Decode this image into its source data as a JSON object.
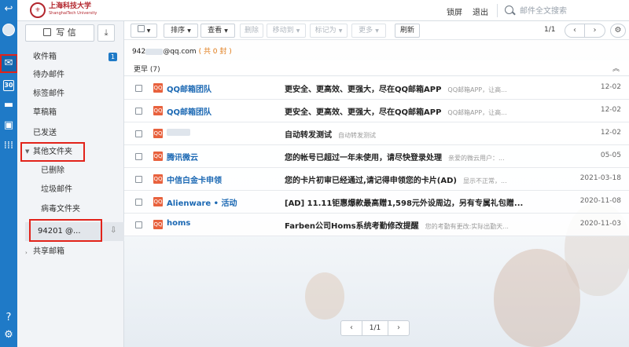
{
  "header": {
    "logo_cn": "上海科技大学",
    "logo_en": "ShanghaiTech University",
    "lock_label": "锁屏",
    "logout_label": "退出",
    "search_placeholder": "邮件全文搜索"
  },
  "sidebar": {
    "compose_label": "写 信",
    "inbox_label": "收件箱",
    "inbox_badge": "1",
    "todo_label": "待办邮件",
    "tagged_label": "标签邮件",
    "drafts_label": "草稿箱",
    "sent_label": "已发送",
    "other_folders_label": "其他文件夹",
    "deleted_label": "已删除",
    "spam_label": "垃圾邮件",
    "virus_label": "病毒文件夹",
    "account_label": "94201 @...",
    "shared_label": "共享邮箱"
  },
  "toolbar": {
    "sort_label": "排序",
    "view_label": "查看",
    "delete_label": "删除",
    "move_label": "移动到",
    "mark_label": "标记为",
    "more_label": "更多",
    "refresh_label": "刷新",
    "page_indicator": "1/1"
  },
  "mail_list": {
    "account_prefix": "942",
    "account_suffix": "@qq.com",
    "count_text": "( 共 0 封 )",
    "group_title": "更早 (7)",
    "qq_icon": "QQ",
    "rows": [
      {
        "sender": "QQ邮箱团队",
        "subject": "更安全、更高效、更强大，尽在QQ邮箱APP",
        "preview": "QQ邮箱APP，让高...",
        "date": "12-02"
      },
      {
        "sender": "QQ邮箱团队",
        "subject": "更安全、更高效、更强大，尽在QQ邮箱APP",
        "preview": "QQ邮箱APP，让高...",
        "date": "12-02"
      },
      {
        "sender": "",
        "subject": "自动转发测试",
        "preview": "自动转发测试",
        "date": "12-02"
      },
      {
        "sender": "腾讯微云",
        "subject": "您的帐号已超过一年未使用，请尽快登录处理",
        "preview": "亲爱的微云用户：...",
        "date": "05-05"
      },
      {
        "sender": "中信白金卡申领",
        "subject": "您的卡片初审已经通过,请记得申领您的卡片(AD)",
        "preview": "显示不正常，...",
        "date": "2021-03-18"
      },
      {
        "sender": "Alienware • 活动",
        "subject": "[AD] 11.11钜惠爆款最高赠1,598元外设周边，另有专属礼包赠...",
        "preview": "",
        "date": "2020-11-08"
      },
      {
        "sender": "homs",
        "subject": "Farben公司Homs系统考勤修改提醒",
        "preview": "您的考勤有更改:实际出勤天...",
        "date": "2020-11-03"
      }
    ]
  },
  "pagination": {
    "label": "1/1"
  },
  "icons": {
    "back": "back-icon",
    "avatar": "avatar-icon",
    "mail": "mail-icon",
    "calendar": "calendar-icon",
    "folder": "folder-icon",
    "contacts": "contacts-icon",
    "apps": "apps-grid-icon",
    "help": "help-icon",
    "settings": "settings-gear-icon",
    "search": "search-icon",
    "compose": "pen-icon",
    "upload": "upload-icon",
    "qq": "qq-mail-icon"
  },
  "colors": {
    "rail": "#1f7ac7",
    "sender_link": "#1b68b3",
    "highlight_box": "#e2231a",
    "qq_badge": "#e8613d"
  },
  "calendar_day": "30"
}
